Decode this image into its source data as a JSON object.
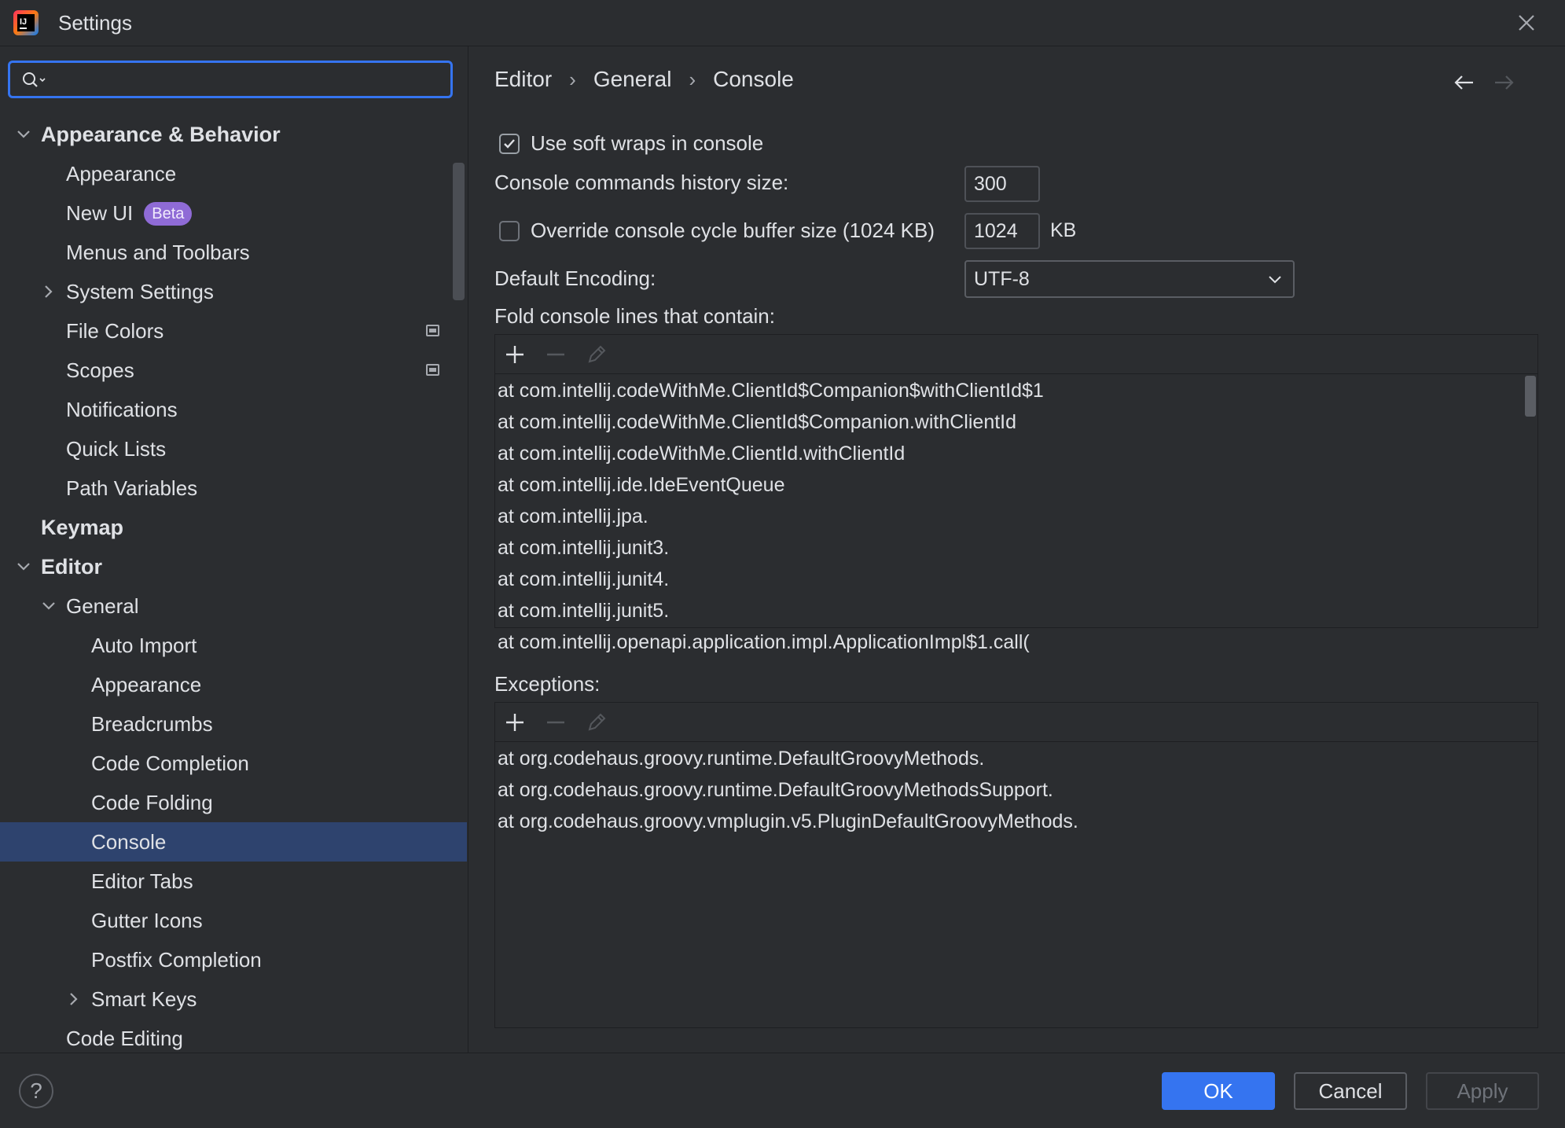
{
  "window": {
    "title": "Settings"
  },
  "search": {
    "placeholder": "",
    "value": ""
  },
  "sidebar": {
    "items": [
      {
        "label": "Appearance & Behavior"
      },
      {
        "label": "Appearance"
      },
      {
        "label": "New UI",
        "badge": "Beta"
      },
      {
        "label": "Menus and Toolbars"
      },
      {
        "label": "System Settings"
      },
      {
        "label": "File Colors"
      },
      {
        "label": "Scopes"
      },
      {
        "label": "Notifications"
      },
      {
        "label": "Quick Lists"
      },
      {
        "label": "Path Variables"
      },
      {
        "label": "Keymap"
      },
      {
        "label": "Editor"
      },
      {
        "label": "General"
      },
      {
        "label": "Auto Import"
      },
      {
        "label": "Appearance"
      },
      {
        "label": "Breadcrumbs"
      },
      {
        "label": "Code Completion"
      },
      {
        "label": "Code Folding"
      },
      {
        "label": "Console"
      },
      {
        "label": "Editor Tabs"
      },
      {
        "label": "Gutter Icons"
      },
      {
        "label": "Postfix Completion"
      },
      {
        "label": "Smart Keys"
      },
      {
        "label": "Code Editing"
      }
    ],
    "selected": "Console"
  },
  "breadcrumb": {
    "items": [
      "Editor",
      "General",
      "Console"
    ]
  },
  "settings": {
    "soft_wraps": {
      "label": "Use soft wraps in console",
      "checked": true
    },
    "history_size": {
      "label": "Console commands history size:",
      "value": "300"
    },
    "cycle_buffer": {
      "label": "Override console cycle buffer size (1024 KB)",
      "checked": false,
      "value": "1024",
      "unit": "KB"
    },
    "encoding": {
      "label": "Default Encoding:",
      "value": "UTF-8"
    },
    "fold_lines": {
      "label": "Fold console lines that contain:",
      "items": [
        "at com.intellij.codeWithMe.ClientId$Companion$withClientId$1",
        "at com.intellij.codeWithMe.ClientId$Companion.withClientId",
        "at com.intellij.codeWithMe.ClientId.withClientId",
        "at com.intellij.ide.IdeEventQueue",
        "at com.intellij.jpa.",
        "at com.intellij.junit3.",
        "at com.intellij.junit4.",
        "at com.intellij.junit5.",
        "at com.intellij.openapi.application.impl.ApplicationImpl$1.call("
      ]
    },
    "exceptions": {
      "label": "Exceptions:",
      "items": [
        "at org.codehaus.groovy.runtime.DefaultGroovyMethods.",
        "at org.codehaus.groovy.runtime.DefaultGroovyMethodsSupport.",
        "at org.codehaus.groovy.vmplugin.v5.PluginDefaultGroovyMethods."
      ]
    }
  },
  "footer": {
    "help": "?",
    "ok": "OK",
    "cancel": "Cancel",
    "apply": "Apply"
  },
  "colors": {
    "accent": "#3574f0",
    "selection": "#2e436e",
    "background": "#2b2d30",
    "badge": "#8f6bd6"
  }
}
